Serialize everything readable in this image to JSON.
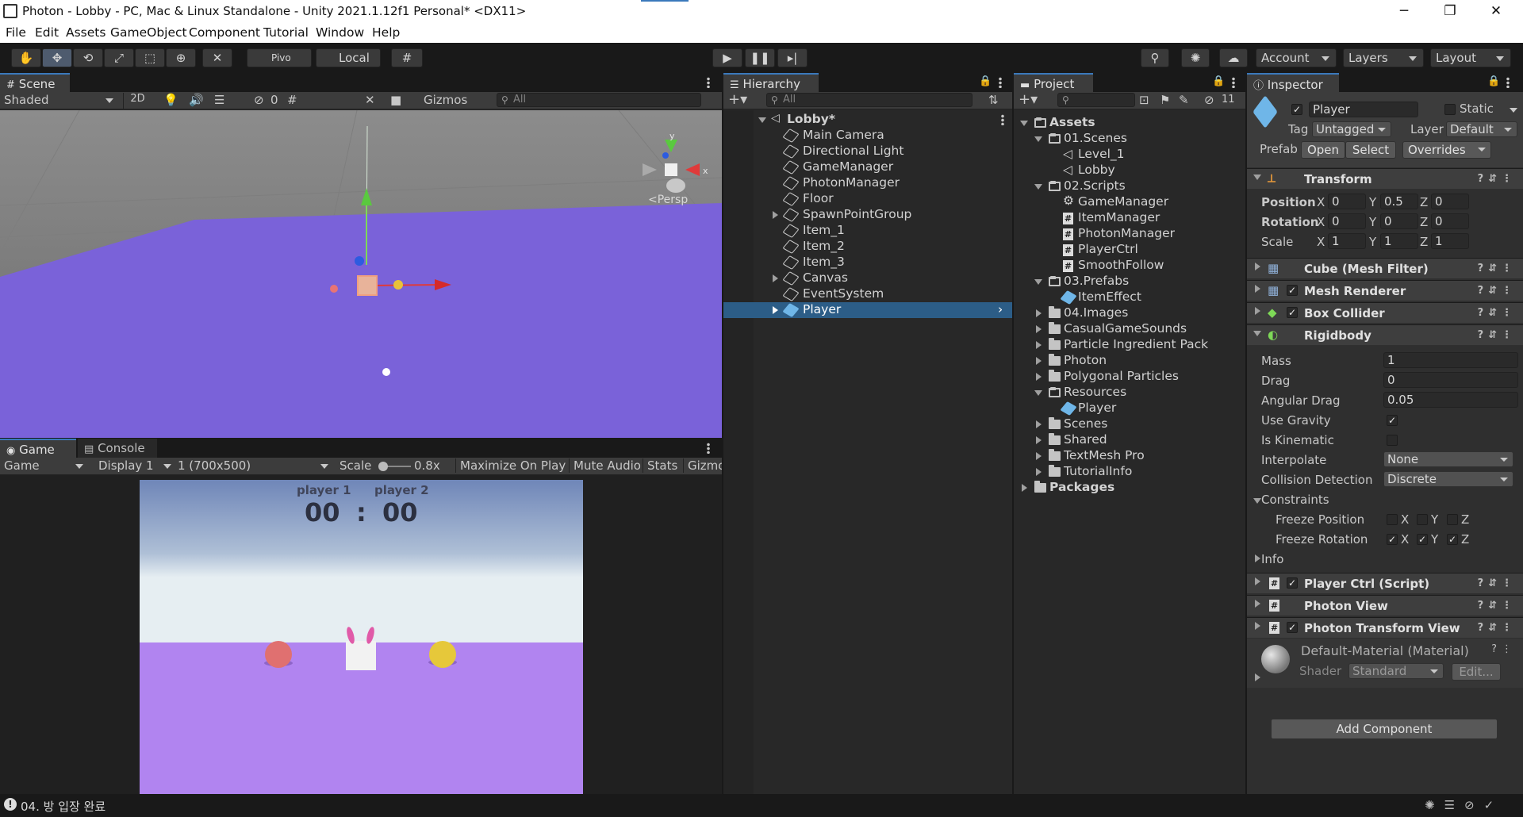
{
  "window": {
    "title": "Photon - Lobby - PC, Mac & Linux Standalone - Unity 2021.1.12f1 Personal* <DX11>",
    "minimize": "─",
    "restore": "❐",
    "close": "✕"
  },
  "menu": [
    "File",
    "Edit",
    "Assets",
    "GameObject",
    "Component",
    "Tutorial",
    "Window",
    "Help"
  ],
  "toolbar": {
    "pivot_label": "Pivo",
    "local_label": "Local",
    "account_label": "Account",
    "layers_label": "Layers",
    "layout_label": "Layout"
  },
  "scene": {
    "tab_label": "Scene",
    "shading": "Shaded",
    "mode_2d": "2D",
    "hidden_count": "0",
    "gizmos_label": "Gizmos",
    "search_placeholder": "All",
    "persp_label": "<Persp",
    "axis_y": "y",
    "axis_x": "x"
  },
  "game": {
    "tab_label": "Game",
    "console_tab_label": "Console",
    "view_select": "Game",
    "display": "Display 1",
    "resolution": "1 (700x500)",
    "scale_label": "Scale",
    "scale_value": "0.8x",
    "maximize_label": "Maximize On Play",
    "mute_label": "Mute Audio",
    "stats_label": "Stats",
    "gizmos_label": "Gizmo",
    "player1_label": "player 1",
    "player2_label": "player 2",
    "score1": "00",
    "score_sep": ":",
    "score2": "00"
  },
  "hierarchy": {
    "tab_label": "Hierarchy",
    "search_placeholder": "All",
    "root": "Lobby*",
    "items": [
      {
        "label": "Main Camera",
        "expandable": false,
        "selected": false
      },
      {
        "label": "Directional Light",
        "expandable": false,
        "selected": false
      },
      {
        "label": "GameManager",
        "expandable": false,
        "selected": false
      },
      {
        "label": "PhotonManager",
        "expandable": false,
        "selected": false
      },
      {
        "label": "Floor",
        "expandable": false,
        "selected": false
      },
      {
        "label": "SpawnPointGroup",
        "expandable": true,
        "selected": false
      },
      {
        "label": "Item_1",
        "expandable": false,
        "selected": false
      },
      {
        "label": "Item_2",
        "expandable": false,
        "selected": false
      },
      {
        "label": "Item_3",
        "expandable": false,
        "selected": false
      },
      {
        "label": "Canvas",
        "expandable": true,
        "selected": false
      },
      {
        "label": "EventSystem",
        "expandable": false,
        "selected": false
      },
      {
        "label": "Player",
        "expandable": true,
        "selected": true
      }
    ]
  },
  "project": {
    "tab_label": "Project",
    "hidden_count": "11",
    "tree": [
      {
        "label": "Assets",
        "depth": 0,
        "kind": "folder-open",
        "bold": true
      },
      {
        "label": "01.Scenes",
        "depth": 1,
        "kind": "folder-open"
      },
      {
        "label": "Level_1",
        "depth": 2,
        "kind": "scene"
      },
      {
        "label": "Lobby",
        "depth": 2,
        "kind": "scene"
      },
      {
        "label": "02.Scripts",
        "depth": 1,
        "kind": "folder-open"
      },
      {
        "label": "GameManager",
        "depth": 2,
        "kind": "gear"
      },
      {
        "label": "ItemManager",
        "depth": 2,
        "kind": "script"
      },
      {
        "label": "PhotonManager",
        "depth": 2,
        "kind": "script"
      },
      {
        "label": "PlayerCtrl",
        "depth": 2,
        "kind": "script"
      },
      {
        "label": "SmoothFollow",
        "depth": 2,
        "kind": "script"
      },
      {
        "label": "03.Prefabs",
        "depth": 1,
        "kind": "folder-open"
      },
      {
        "label": "ItemEffect",
        "depth": 2,
        "kind": "prefab"
      },
      {
        "label": "04.Images",
        "depth": 1,
        "kind": "folder"
      },
      {
        "label": "CasualGameSounds",
        "depth": 1,
        "kind": "folder"
      },
      {
        "label": "Particle Ingredient Pack",
        "depth": 1,
        "kind": "folder"
      },
      {
        "label": "Photon",
        "depth": 1,
        "kind": "folder"
      },
      {
        "label": "Polygonal Particles",
        "depth": 1,
        "kind": "folder"
      },
      {
        "label": "Resources",
        "depth": 1,
        "kind": "folder-open"
      },
      {
        "label": "Player",
        "depth": 2,
        "kind": "prefab"
      },
      {
        "label": "Scenes",
        "depth": 1,
        "kind": "folder"
      },
      {
        "label": "Shared",
        "depth": 1,
        "kind": "folder"
      },
      {
        "label": "TextMesh Pro",
        "depth": 1,
        "kind": "folder"
      },
      {
        "label": "TutorialInfo",
        "depth": 1,
        "kind": "folder"
      },
      {
        "label": "Packages",
        "depth": 0,
        "kind": "folder",
        "bold": true
      }
    ]
  },
  "inspector": {
    "tab_label": "Inspector",
    "object_name": "Player",
    "static_label": "Static",
    "tag_label": "Tag",
    "tag_value": "Untagged",
    "layer_label": "Layer",
    "layer_value": "Default",
    "prefab_label": "Prefab",
    "open_label": "Open",
    "select_label": "Select",
    "overrides_label": "Overrides",
    "transform": {
      "title": "Transform",
      "position_label": "Position",
      "rotation_label": "Rotation",
      "scale_label": "Scale",
      "x": "X",
      "y": "Y",
      "z": "Z",
      "pos": [
        "0",
        "0.5",
        "0"
      ],
      "rot": [
        "0",
        "0",
        "0"
      ],
      "scl": [
        "1",
        "1",
        "1"
      ]
    },
    "components": {
      "mesh_filter": "Cube (Mesh Filter)",
      "mesh_renderer": "Mesh Renderer",
      "box_collider": "Box Collider",
      "rigidbody": "Rigidbody",
      "player_ctrl": "Player Ctrl (Script)",
      "photon_view": "Photon View",
      "photon_transform_view": "Photon Transform View"
    },
    "rigidbody": {
      "mass_label": "Mass",
      "mass": "1",
      "drag_label": "Drag",
      "drag": "0",
      "angular_drag_label": "Angular Drag",
      "angular_drag": "0.05",
      "use_gravity_label": "Use Gravity",
      "is_kinematic_label": "Is Kinematic",
      "interpolate_label": "Interpolate",
      "interpolate": "None",
      "collision_label": "Collision Detection",
      "collision": "Discrete",
      "constraints_label": "Constraints",
      "freeze_pos_label": "Freeze Position",
      "freeze_rot_label": "Freeze Rotation",
      "info_label": "Info"
    },
    "material": {
      "name": "Default-Material (Material)",
      "shader_label": "Shader",
      "shader_value": "Standard",
      "edit_label": "Edit..."
    },
    "add_component_label": "Add Component"
  },
  "status": {
    "message": "04. 방 입장 완료"
  },
  "colors": {
    "accent": "#3a79bb",
    "selection": "#2c5d87",
    "floor_scene": "#7a62d9",
    "floor_game": "#b184f0"
  }
}
